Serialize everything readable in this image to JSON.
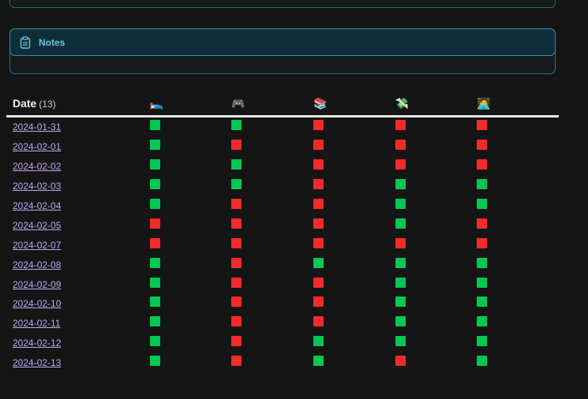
{
  "notes_callout": {
    "title": "Notes",
    "icon": "clipboard-icon"
  },
  "table": {
    "date_header": "Date",
    "count": "(13)",
    "habits": [
      {
        "emoji": "🛌",
        "icon": "bed-icon"
      },
      {
        "emoji": "🎮",
        "icon": "gamepad-icon"
      },
      {
        "emoji": "📚",
        "icon": "books-icon"
      },
      {
        "emoji": "💸",
        "icon": "money-wings-icon"
      },
      {
        "emoji": "🧑‍💻",
        "icon": "technologist-icon"
      }
    ],
    "rows": [
      {
        "date": "2024-01-31",
        "values": [
          true,
          true,
          false,
          false,
          false
        ]
      },
      {
        "date": "2024-02-01",
        "values": [
          true,
          false,
          false,
          false,
          false
        ]
      },
      {
        "date": "2024-02-02",
        "values": [
          true,
          true,
          false,
          false,
          false
        ]
      },
      {
        "date": "2024-02-03",
        "values": [
          true,
          true,
          false,
          true,
          true
        ]
      },
      {
        "date": "2024-02-04",
        "values": [
          true,
          false,
          false,
          true,
          true
        ]
      },
      {
        "date": "2024-02-05",
        "values": [
          false,
          false,
          false,
          true,
          false
        ]
      },
      {
        "date": "2024-02-07",
        "values": [
          false,
          false,
          false,
          false,
          false
        ]
      },
      {
        "date": "2024-02-08",
        "values": [
          true,
          false,
          true,
          true,
          true
        ]
      },
      {
        "date": "2024-02-09",
        "values": [
          true,
          false,
          false,
          true,
          true
        ]
      },
      {
        "date": "2024-02-10",
        "values": [
          true,
          false,
          false,
          true,
          true
        ]
      },
      {
        "date": "2024-02-11",
        "values": [
          true,
          false,
          false,
          true,
          true
        ]
      },
      {
        "date": "2024-02-12",
        "values": [
          true,
          false,
          true,
          true,
          true
        ]
      },
      {
        "date": "2024-02-13",
        "values": [
          true,
          false,
          true,
          false,
          true
        ]
      }
    ]
  },
  "colors": {
    "done": "#00c853",
    "miss": "#f42b2b",
    "link": "#b9a9f5",
    "notes_accent": "#6cc3dc"
  }
}
